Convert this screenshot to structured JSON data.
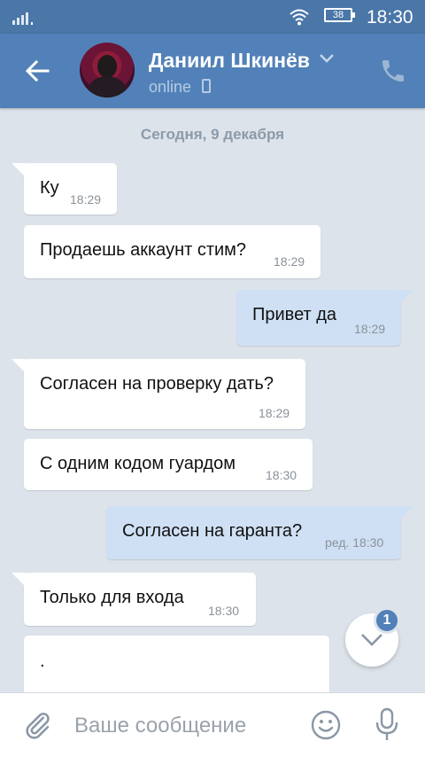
{
  "status_bar": {
    "battery": "38",
    "time": "18:30"
  },
  "header": {
    "contact_name": "Даниил Шкинёв",
    "status": "online"
  },
  "date_divider": "Сегодня, 9 декабря",
  "messages": [
    {
      "dir": "in",
      "text": "Ку",
      "time": "18:29"
    },
    {
      "dir": "in",
      "text": "Продаешь аккаунт стим?",
      "time": "18:29"
    },
    {
      "dir": "out",
      "text": "Привет да",
      "time": "18:29"
    },
    {
      "dir": "in",
      "text": "Согласен на проверку дать?",
      "time": "18:29"
    },
    {
      "dir": "in",
      "text": "С одним кодом гуардом",
      "time": "18:30"
    },
    {
      "dir": "out",
      "text": "Согласен на гаранта?",
      "time": "ред. 18:30"
    },
    {
      "dir": "in",
      "text": "Только для входа",
      "time": "18:30"
    },
    {
      "dir": "in",
      "text": ".",
      "time": ""
    }
  ],
  "scroll_down": {
    "unread_count": "1"
  },
  "input": {
    "placeholder": "Ваше сообщение",
    "value": ""
  },
  "colors": {
    "header": "#5181b8",
    "status_bar": "#4a76a8",
    "background": "#dde3ea",
    "outgoing": "#cfe0f4",
    "incoming": "#ffffff"
  },
  "icons": [
    "back-arrow-icon",
    "chevron-down-icon",
    "phone-icon",
    "attach-icon",
    "emoji-icon",
    "microphone-icon",
    "chevron-down-icon"
  ]
}
